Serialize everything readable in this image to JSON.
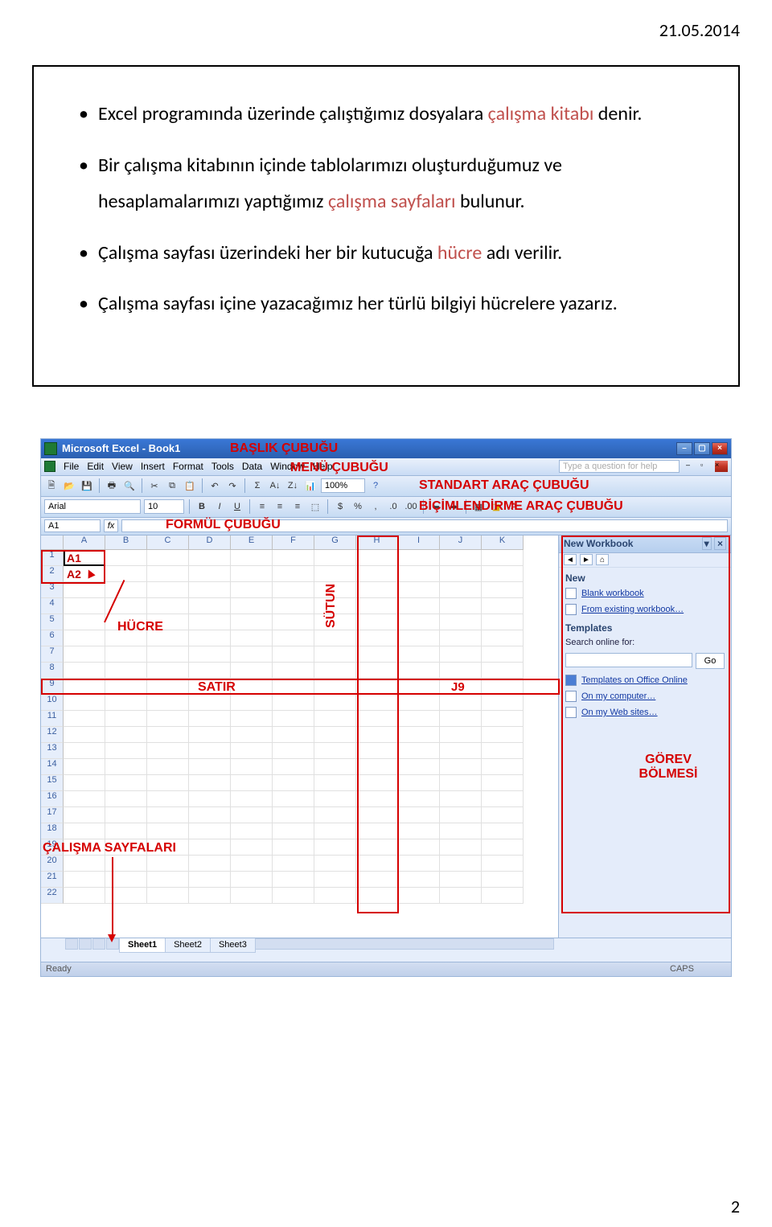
{
  "page_date": "21.05.2014",
  "page_number": "2",
  "bullets": [
    {
      "pre": "Excel programında üzerinde çalıştığımız dosyalara ",
      "em": "çalışma kitabı",
      "post": " denir."
    },
    {
      "pre": "Bir çalışma kitabının içinde tablolarımızı oluşturduğumuz ve hesaplamalarımızı yaptığımız ",
      "em": "çalışma sayfaları",
      "post": " bulunur."
    },
    {
      "pre": "Çalışma sayfası üzerindeki her bir kutucuğa ",
      "em": "hücre",
      "post": " adı verilir."
    },
    {
      "pre": "Çalışma sayfası içine yazacağımız her türlü bilgiyi hücrelere yazarız.",
      "em": "",
      "post": ""
    }
  ],
  "titlebar": "Microsoft Excel - Book1",
  "menubar": [
    "File",
    "Edit",
    "View",
    "Insert",
    "Format",
    "Tools",
    "Data",
    "Window",
    "Help"
  ],
  "question_help": "Type a question for help",
  "standard_toolbar_zoom": "100%",
  "font": "Arial",
  "fontsize": "10",
  "namebox": "A1",
  "fx": "fx",
  "columns": [
    "A",
    "B",
    "C",
    "D",
    "E",
    "F",
    "G",
    "H",
    "I",
    "J",
    "K"
  ],
  "rows": [
    "1",
    "2",
    "3",
    "4",
    "5",
    "6",
    "7",
    "8",
    "9",
    "10",
    "11",
    "12",
    "13",
    "14",
    "15",
    "16",
    "17",
    "18",
    "19",
    "20",
    "21",
    "22"
  ],
  "sheet_tabs": [
    "Sheet1",
    "Sheet2",
    "Sheet3"
  ],
  "status_text": "Ready",
  "caps_text": "CAPS",
  "taskpane": {
    "title": "New Workbook",
    "section_new": "New",
    "new_items": [
      "Blank workbook",
      "From existing workbook…"
    ],
    "section_templates": "Templates",
    "search_label": "Search online for:",
    "go_btn": "Go",
    "template_items": [
      "Templates on Office Online",
      "On my computer…",
      "On my Web sites…"
    ]
  },
  "annotations": {
    "baslik": "BAŞLIK ÇUBUĞU",
    "menu": "MENÜ ÇUBUĞU",
    "standart": "STANDART ARAÇ ÇUBUĞU",
    "bicim": "BİÇİMLENDİRME ARAÇ ÇUBUĞU",
    "formul": "FORMÜL ÇUBUĞU",
    "a1": "A1",
    "a2": "A2",
    "hucre": "HÜCRE",
    "sutun": "SÜTUN",
    "satir": "SATIR",
    "j9": "J9",
    "gorev": "GÖREV BÖLMESİ",
    "calisma": "ÇALIŞMA SAYFALARI"
  }
}
